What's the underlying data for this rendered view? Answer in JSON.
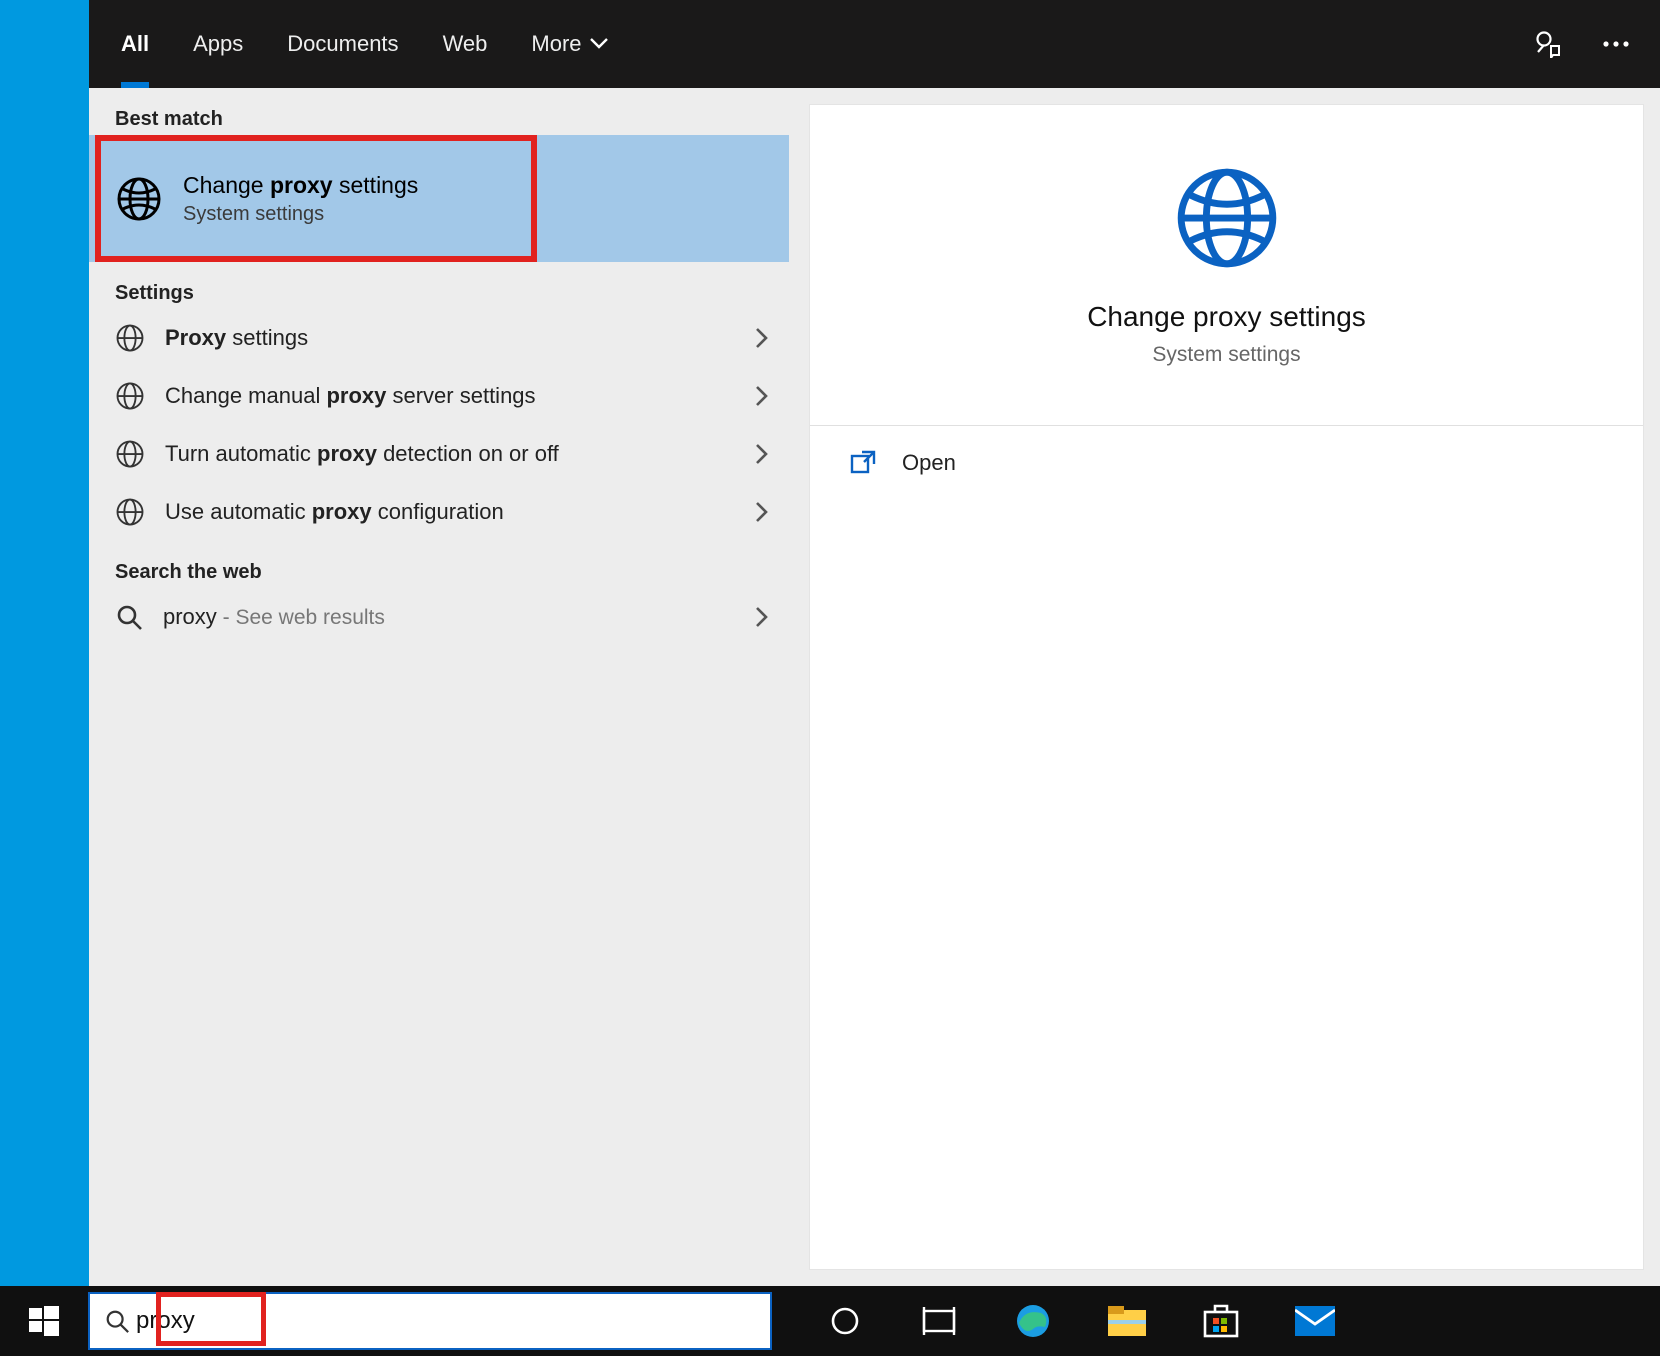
{
  "header": {
    "tabs": {
      "all": "All",
      "apps": "Apps",
      "documents": "Documents",
      "web": "Web",
      "more": "More"
    }
  },
  "results": {
    "best_match_label": "Best match",
    "best_match": {
      "title_pre": "Change ",
      "title_bold": "proxy",
      "title_post": " settings",
      "subtitle": "System settings"
    },
    "settings_label": "Settings",
    "settings": [
      {
        "pre": "",
        "bold": "Proxy",
        "post": " settings"
      },
      {
        "pre": "Change manual ",
        "bold": "proxy",
        "post": " server settings"
      },
      {
        "pre": "Turn automatic ",
        "bold": "proxy",
        "post": " detection on or off"
      },
      {
        "pre": "Use automatic ",
        "bold": "proxy",
        "post": " configuration"
      }
    ],
    "web_label": "Search the web",
    "web_item": {
      "term": "proxy",
      "hint": " - See web results"
    }
  },
  "preview": {
    "title": "Change proxy settings",
    "subtitle": "System settings",
    "open": "Open"
  },
  "search": {
    "value": "proxy"
  }
}
